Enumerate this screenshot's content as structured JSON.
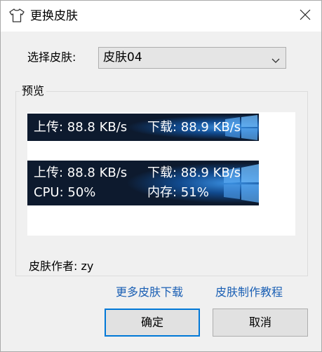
{
  "window": {
    "title": "更换皮肤",
    "title_icon": "shirt-icon",
    "close_icon": "close-icon"
  },
  "skin_select": {
    "label": "选择皮肤:",
    "value": "皮肤04"
  },
  "preview": {
    "label": "预览",
    "skin_small": {
      "upload": "上传: 88.8 KB/s",
      "download": "下载: 88.9 KB/s"
    },
    "skin_large": {
      "upload": "上传: 88.8 KB/s",
      "download": "下载: 88.9 KB/s",
      "cpu": "CPU: 50%",
      "memory": "内存: 51%"
    },
    "author": "皮肤作者:  zy"
  },
  "links": {
    "more_skins": "更多皮肤下载",
    "tutorial": "皮肤制作教程"
  },
  "buttons": {
    "ok": "确定",
    "cancel": "取消"
  },
  "colors": {
    "accent": "#0078d7",
    "link": "#1a5fb4",
    "skin_bg": "#0d1a2e"
  }
}
